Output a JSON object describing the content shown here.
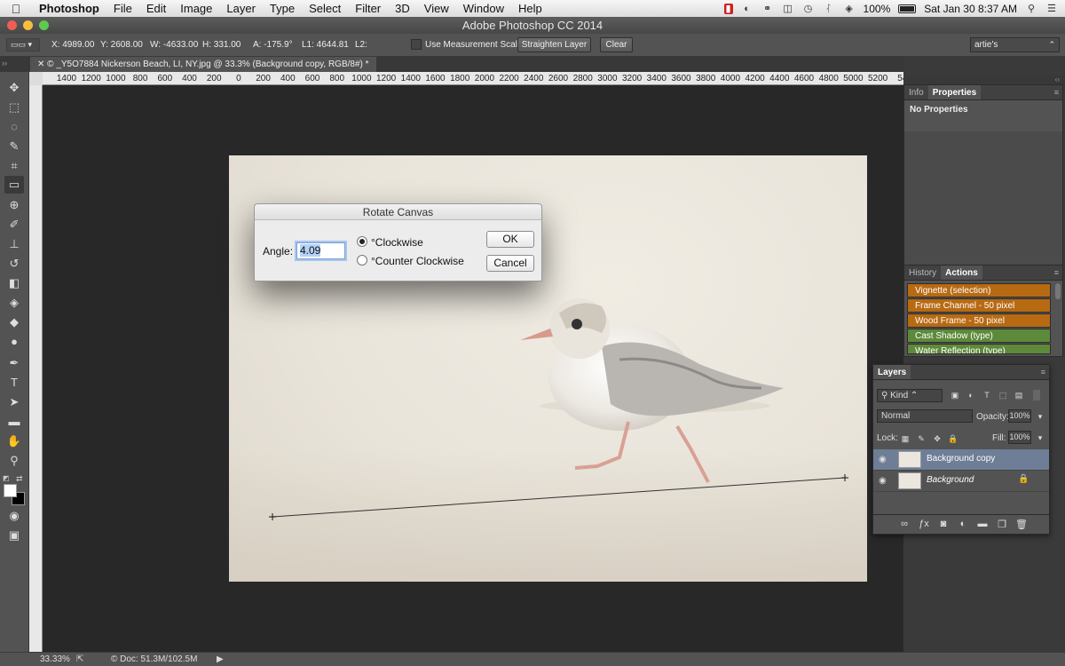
{
  "menubar": {
    "app": "Photoshop",
    "items": [
      "File",
      "Edit",
      "Image",
      "Layer",
      "Type",
      "Select",
      "Filter",
      "3D",
      "View",
      "Window",
      "Help"
    ],
    "battery": "100%",
    "datetime": "Sat Jan 30  8:37 AM"
  },
  "window": {
    "title": "Adobe Photoshop CC 2014"
  },
  "options": {
    "x": "X: 4989.00",
    "y": "Y: 2608.00",
    "w": "W: -4633.00",
    "h": "H: 331.00",
    "a": "A: -175.9°",
    "l1": "L1: 4644.81",
    "l2": "L2:",
    "use_scale": "Use Measurement Scale",
    "straighten": "Straighten Layer",
    "clear": "Clear",
    "workspace": "artie's"
  },
  "document": {
    "tab": "© _Y5O7884  Nickerson Beach, LI, NY.jpg @ 33.3% (Background copy, RGB/8#) *"
  },
  "ruler": {
    "h_ticks": [
      "1400",
      "1200",
      "1000",
      "800",
      "600",
      "400",
      "200",
      "0",
      "200",
      "400",
      "600",
      "800",
      "1000",
      "1200",
      "1400",
      "1600",
      "1800",
      "2000",
      "2200",
      "2400",
      "2600",
      "2800",
      "3000",
      "3200",
      "3400",
      "3600",
      "3800",
      "4000",
      "4200",
      "4400",
      "4600",
      "4800",
      "5000",
      "5200",
      "54"
    ]
  },
  "status": {
    "zoom": "33.33%",
    "doc": "© Doc: 51.3M/102.5M"
  },
  "panels": {
    "info_tab": "Info",
    "properties_tab": "Properties",
    "no_properties": "No Properties",
    "history_tab": "History",
    "actions_tab": "Actions",
    "actions": [
      {
        "label": "Vignette (selection)",
        "color": "#b86a12"
      },
      {
        "label": "Frame Channel - 50 pixel",
        "color": "#b86a12"
      },
      {
        "label": "Wood Frame - 50 pixel",
        "color": "#b86a12"
      },
      {
        "label": "Cast Shadow (type)",
        "color": "#5d8a3a"
      },
      {
        "label": "Water Reflection (type)",
        "color": "#5d8a3a"
      }
    ],
    "layers_tab": "Layers",
    "kind": "Kind",
    "blend": "Normal",
    "opacity_label": "Opacity:",
    "opacity": "100%",
    "lock_label": "Lock:",
    "fill_label": "Fill:",
    "fill": "100%",
    "layers": [
      {
        "name": "Background copy",
        "selected": true
      },
      {
        "name": "Background",
        "selected": false
      }
    ]
  },
  "dialog": {
    "title": "Rotate Canvas",
    "angle_label": "Angle:",
    "angle_value": "4.09",
    "cw": "°Clockwise",
    "ccw": "°Counter Clockwise",
    "ok": "OK",
    "cancel": "Cancel"
  },
  "colors": {
    "selection": "#6d7e96",
    "action_orange": "#b86a12",
    "action_green": "#5d8a3a"
  }
}
